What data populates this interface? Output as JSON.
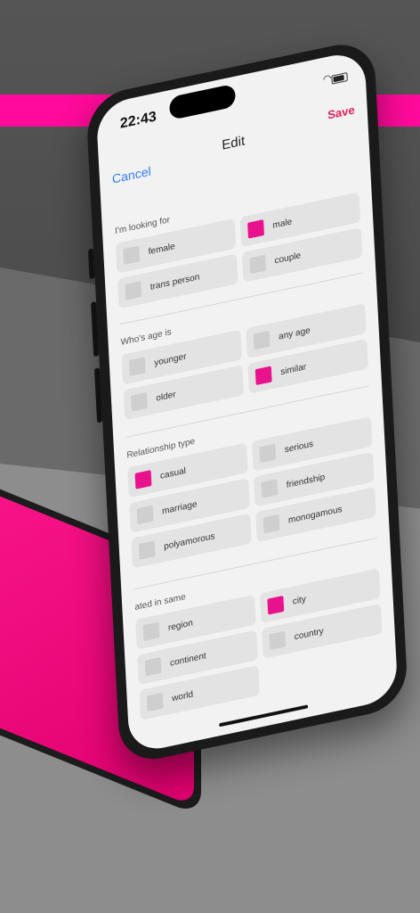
{
  "status": {
    "time": "22:43"
  },
  "nav": {
    "cancel": "Cancel",
    "title": "Edit",
    "save": "Save"
  },
  "sections": [
    {
      "label": "I'm looking for",
      "options": [
        {
          "label": "female",
          "checked": false
        },
        {
          "label": "male",
          "checked": true
        },
        {
          "label": "trans person",
          "checked": false
        },
        {
          "label": "couple",
          "checked": false
        }
      ]
    },
    {
      "label": "Who's age is",
      "options": [
        {
          "label": "younger",
          "checked": false
        },
        {
          "label": "any age",
          "checked": false
        },
        {
          "label": "older",
          "checked": false
        },
        {
          "label": "similar",
          "checked": true
        }
      ]
    },
    {
      "label": "Relationship type",
      "options": [
        {
          "label": "casual",
          "checked": true
        },
        {
          "label": "serious",
          "checked": false
        },
        {
          "label": "marriage",
          "checked": false
        },
        {
          "label": "friendship",
          "checked": false
        },
        {
          "label": "polyamorous",
          "checked": false
        },
        {
          "label": "monogamous",
          "checked": false
        }
      ]
    },
    {
      "label": "ated in same",
      "options": [
        {
          "label": "region",
          "checked": false
        },
        {
          "label": "city",
          "checked": true
        },
        {
          "label": "continent",
          "checked": false
        },
        {
          "label": "country",
          "checked": false
        },
        {
          "label": "world",
          "checked": false
        }
      ]
    }
  ],
  "colors": {
    "accent": "#e8128c",
    "cancel": "#2f7bf5",
    "save": "#e0205a",
    "band": "#ff0a9a"
  }
}
